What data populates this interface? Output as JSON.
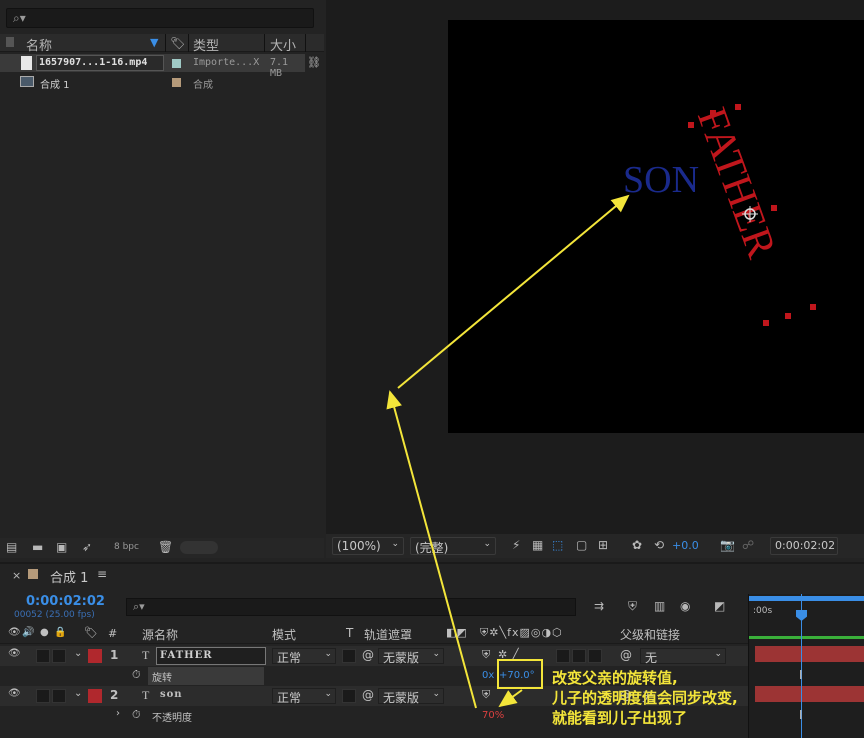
{
  "project": {
    "search_placeholder": "",
    "columns": {
      "name": "名称",
      "type": "类型",
      "size": "大小"
    },
    "items": [
      {
        "name": "1657907...1-16.mp4",
        "type": "Importe...X",
        "size": "7.1 MB",
        "swatch": "#9fc9c5"
      },
      {
        "name": "合成 1",
        "type": "合成",
        "size": "",
        "swatch": "#b59a7a"
      }
    ],
    "bpc": "8 bpc"
  },
  "viewer": {
    "son_text": "SON",
    "father_text": "FATHER",
    "zoom": "(100%)",
    "quality": "(完整)",
    "exposure": "+0.0",
    "timecode": "0:00:02:02",
    "son_color": "#1a2a8c",
    "father_color": "#c0161c"
  },
  "timeline": {
    "tab_label": "合成 1",
    "timecode": "0:00:02:02",
    "frame_info": "00052 (25.00 fps)",
    "col_headers": {
      "source_name": "源名称",
      "mode": "模式",
      "t": "T",
      "track_matte": "轨道遮罩",
      "parent": "父级和链接",
      "ruler_start": ":00s"
    },
    "layers": [
      {
        "num": "1",
        "name": "FATHER",
        "mode": "正常",
        "matte": "无蒙版",
        "parent": "无"
      },
      {
        "num": "2",
        "name": "son",
        "mode": "正常",
        "matte": "无蒙版",
        "parent": "无"
      }
    ],
    "props": [
      {
        "name": "旋转",
        "value_prefix": "0x",
        "value": "+70.0°"
      },
      {
        "name": "不透明度",
        "value": "70%"
      }
    ]
  },
  "annotation": {
    "line1": "改变父亲的旋转值,",
    "line2": "儿子的透明度值会同步改变,",
    "line3": "就能看到儿子出现了"
  }
}
